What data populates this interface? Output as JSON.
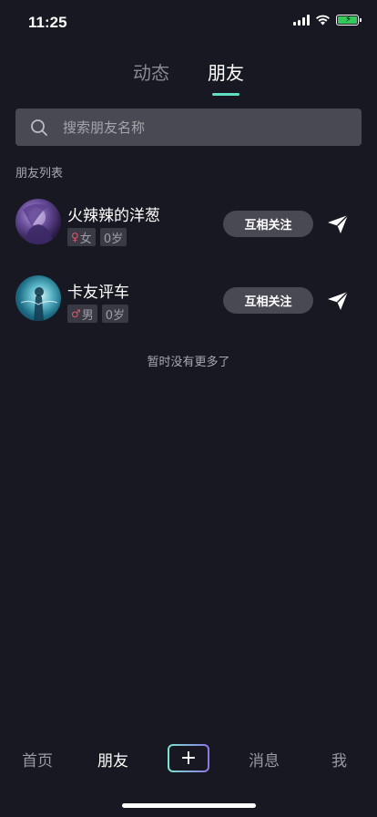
{
  "status": {
    "time": "11:25"
  },
  "top_tabs": [
    {
      "label": "动态",
      "active": false
    },
    {
      "label": "朋友",
      "active": true
    }
  ],
  "search": {
    "placeholder": "搜索朋友名称",
    "value": ""
  },
  "section_label": "朋友列表",
  "friends": [
    {
      "name": "火辣辣的洋葱",
      "gender": "女",
      "gender_icon": "female-icon",
      "age": "0岁",
      "follow_label": "互相关注",
      "avatar": "avatar-purple-figure"
    },
    {
      "name": "卡友评车",
      "gender": "男",
      "gender_icon": "male-icon",
      "age": "0岁",
      "follow_label": "互相关注",
      "avatar": "avatar-blue-figure"
    }
  ],
  "no_more_text": "暂时没有更多了",
  "bottom_nav": {
    "home": "首页",
    "friends": "朋友",
    "add_symbol": "+",
    "messages": "消息",
    "me": "我"
  },
  "colors": {
    "background": "#181823",
    "accent": "#5fdec4",
    "button_bg": "#494953",
    "gender_tag": "#e0566d"
  }
}
